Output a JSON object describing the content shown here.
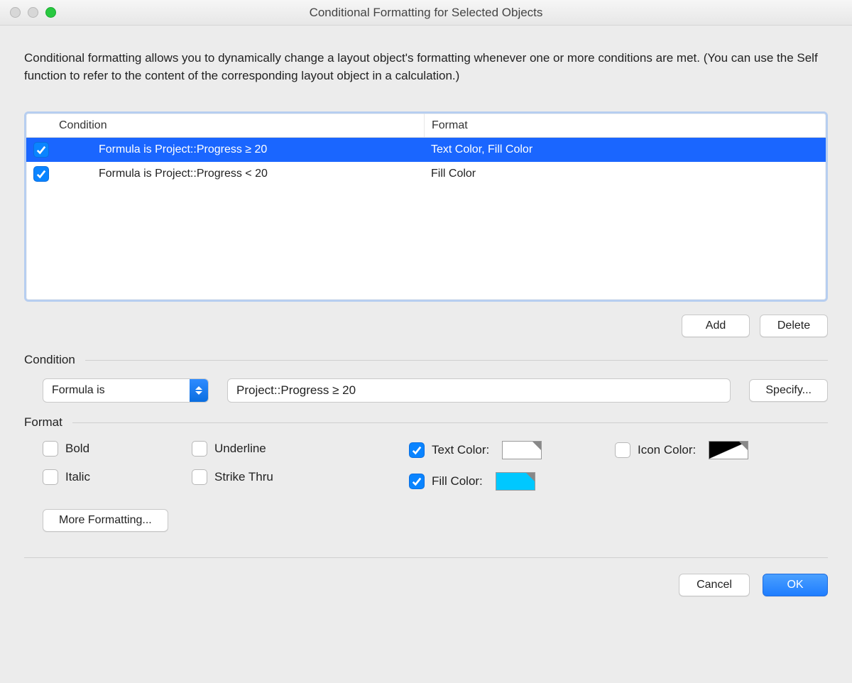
{
  "title": "Conditional Formatting for Selected Objects",
  "intro": "Conditional formatting allows you to dynamically change a layout object's formatting whenever one or more conditions are met.  (You can use the Self function to refer to the content of the corresponding layout object in a calculation.)",
  "columns": {
    "condition": "Condition",
    "format": "Format"
  },
  "rows": [
    {
      "enabled": true,
      "condition": "Formula is Project::Progress ≥ 20",
      "format": "Text Color, Fill Color",
      "selected": true
    },
    {
      "enabled": true,
      "condition": "Formula is Project::Progress < 20",
      "format": "Fill Color",
      "selected": false
    }
  ],
  "buttons": {
    "add": "Add",
    "delete": "Delete",
    "specify": "Specify...",
    "more": "More Formatting...",
    "cancel": "Cancel",
    "ok": "OK"
  },
  "sections": {
    "condition": "Condition",
    "format": "Format"
  },
  "condition_editor": {
    "type_label": "Formula is",
    "formula": "Project::Progress ≥ 20"
  },
  "format_options": {
    "bold": "Bold",
    "italic": "Italic",
    "underline": "Underline",
    "strike": "Strike Thru",
    "text_color": "Text Color:",
    "fill_color": "Fill Color:",
    "icon_color": "Icon Color:"
  },
  "format_state": {
    "bold": false,
    "italic": false,
    "underline": false,
    "strike": false,
    "text_color": true,
    "fill_color": true,
    "icon_color": false
  },
  "colors": {
    "text_color": "#ffffff",
    "fill_color": "#00c8ff",
    "icon_color": "diagonal"
  }
}
